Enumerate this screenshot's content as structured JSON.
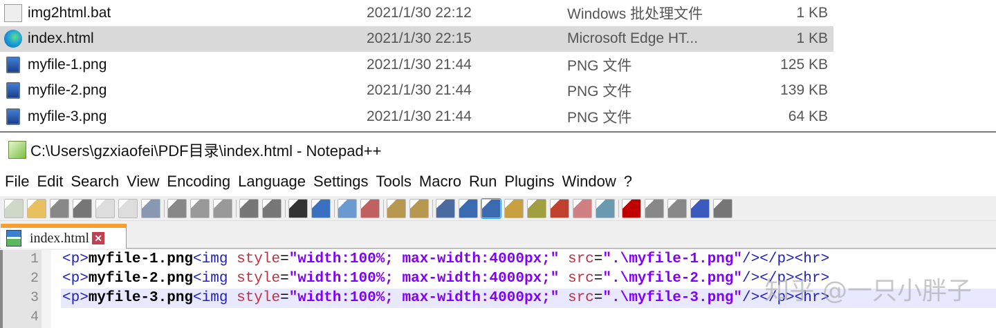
{
  "files": [
    {
      "name": "img2html.bat",
      "date": "2021/1/30 22:12",
      "type": "Windows 批处理文件",
      "size": "1 KB",
      "icon": "bat-file-icon",
      "selected": false
    },
    {
      "name": "index.html",
      "date": "2021/1/30 22:15",
      "type": "Microsoft Edge HT...",
      "size": "1 KB",
      "icon": "edge-icon",
      "selected": true
    },
    {
      "name": "myfile-1.png",
      "date": "2021/1/30 21:44",
      "type": "PNG 文件",
      "size": "125 KB",
      "icon": "png-file-icon",
      "selected": false
    },
    {
      "name": "myfile-2.png",
      "date": "2021/1/30 21:44",
      "type": "PNG 文件",
      "size": "139 KB",
      "icon": "png-file-icon",
      "selected": false
    },
    {
      "name": "myfile-3.png",
      "date": "2021/1/30 21:44",
      "type": "PNG 文件",
      "size": "64 KB",
      "icon": "png-file-icon",
      "selected": false
    }
  ],
  "window": {
    "title": "C:\\Users\\gzxiaofei\\PDF目录\\index.html - Notepad++"
  },
  "menu": [
    "File",
    "Edit",
    "Search",
    "View",
    "Encoding",
    "Language",
    "Settings",
    "Tools",
    "Macro",
    "Run",
    "Plugins",
    "Window",
    "?"
  ],
  "toolbar": [
    "new",
    "open",
    "save",
    "save-all",
    "close",
    "close-all",
    "print",
    "cut",
    "copy",
    "paste",
    "undo",
    "redo",
    "find",
    "replace",
    "zoom-in",
    "zoom-out",
    "sync-vertical",
    "sync-horizontal",
    "word-wrap",
    "show-all-chars",
    "indent-guide",
    "udl",
    "doc-map",
    "function-list",
    "folder-as-workspace",
    "monitoring",
    "record-macro",
    "stop-record",
    "play-macro",
    "run-macro-multiple",
    "save-macro"
  ],
  "tab": {
    "label": "index.html"
  },
  "editor": {
    "lines": [
      {
        "n": "1",
        "p1": "<p>",
        "t": "myfile-1.png",
        "p2": "<img ",
        "a1": "style",
        "e1": "=",
        "v1": "\"width:100%; max-width:4000px;\"",
        "a2": " src",
        "e2": "=",
        "v2": "\".\\myfile-1.png\"",
        "p3": "/></p><hr>"
      },
      {
        "n": "2",
        "p1": "<p>",
        "t": "myfile-2.png",
        "p2": "<img ",
        "a1": "style",
        "e1": "=",
        "v1": "\"width:100%; max-width:4000px;\"",
        "a2": " src",
        "e2": "=",
        "v2": "\".\\myfile-2.png\"",
        "p3": "/></p><hr>"
      },
      {
        "n": "3",
        "p1": "<p>",
        "t": "myfile-3.png",
        "p2": "<img ",
        "a1": "style",
        "e1": "=",
        "v1": "\"width:100%; max-width:4000px;\"",
        "a2": " src",
        "e2": "=",
        "v2": "\".\\myfile-3.png\"",
        "p3": "/></p><hr>"
      },
      {
        "n": "4"
      }
    ],
    "current_line": 3
  },
  "watermark": "知乎 @一只小胖子"
}
